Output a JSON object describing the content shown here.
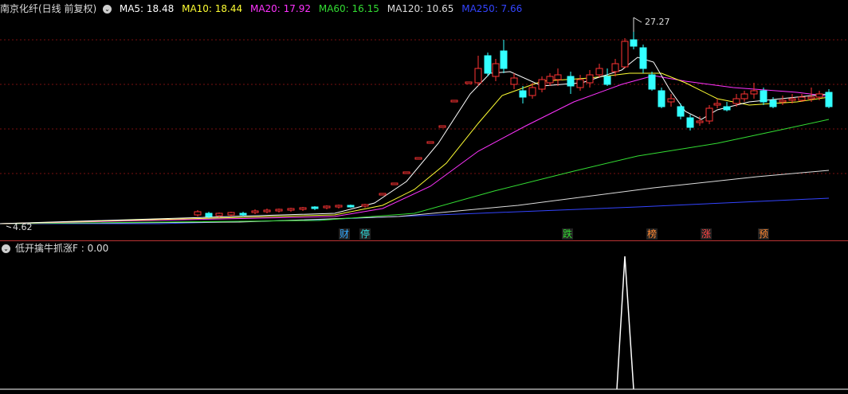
{
  "main_panel": {
    "stock_title": "南京化纤(日线 前复权)",
    "indicators": [
      {
        "label": "MA5: 18.48",
        "color": "#ffffff"
      },
      {
        "label": "MA10: 18.44",
        "color": "#ffff33"
      },
      {
        "label": "MA20: 17.92",
        "color": "#ff33ff"
      },
      {
        "label": "MA60: 16.15",
        "color": "#33dd33"
      },
      {
        "label": "MA120: 10.65",
        "color": "#dddddd"
      },
      {
        "label": "MA250: 7.66",
        "color": "#3344ff"
      }
    ],
    "high_label": "27.27",
    "low_label": "4.62",
    "markers": [
      {
        "text": "财",
        "color": "#33aaff"
      },
      {
        "text": "停",
        "color": "#33dddd"
      },
      {
        "text": "跌",
        "color": "#33dd33"
      },
      {
        "text": "榜",
        "color": "#ff8833"
      },
      {
        "text": "涨",
        "color": "#ff4444"
      },
      {
        "text": "预",
        "color": "#ff8833"
      }
    ]
  },
  "sub_panel": {
    "indicator_label": "低开擒牛抓涨F : 0.00"
  },
  "colors": {
    "up": "#ff3333",
    "down": "#33ffff",
    "grid": "#7a1010",
    "separator": "#b33333"
  },
  "chart_data": {
    "type": "candlestick",
    "price_range": [
      4.62,
      27.27
    ],
    "y_high_label": 27.27,
    "y_low_label": 4.62,
    "indicator_range": [
      0,
      1
    ],
    "indicator_peak_index": 0.78,
    "indicator_peak_value": 1
  }
}
